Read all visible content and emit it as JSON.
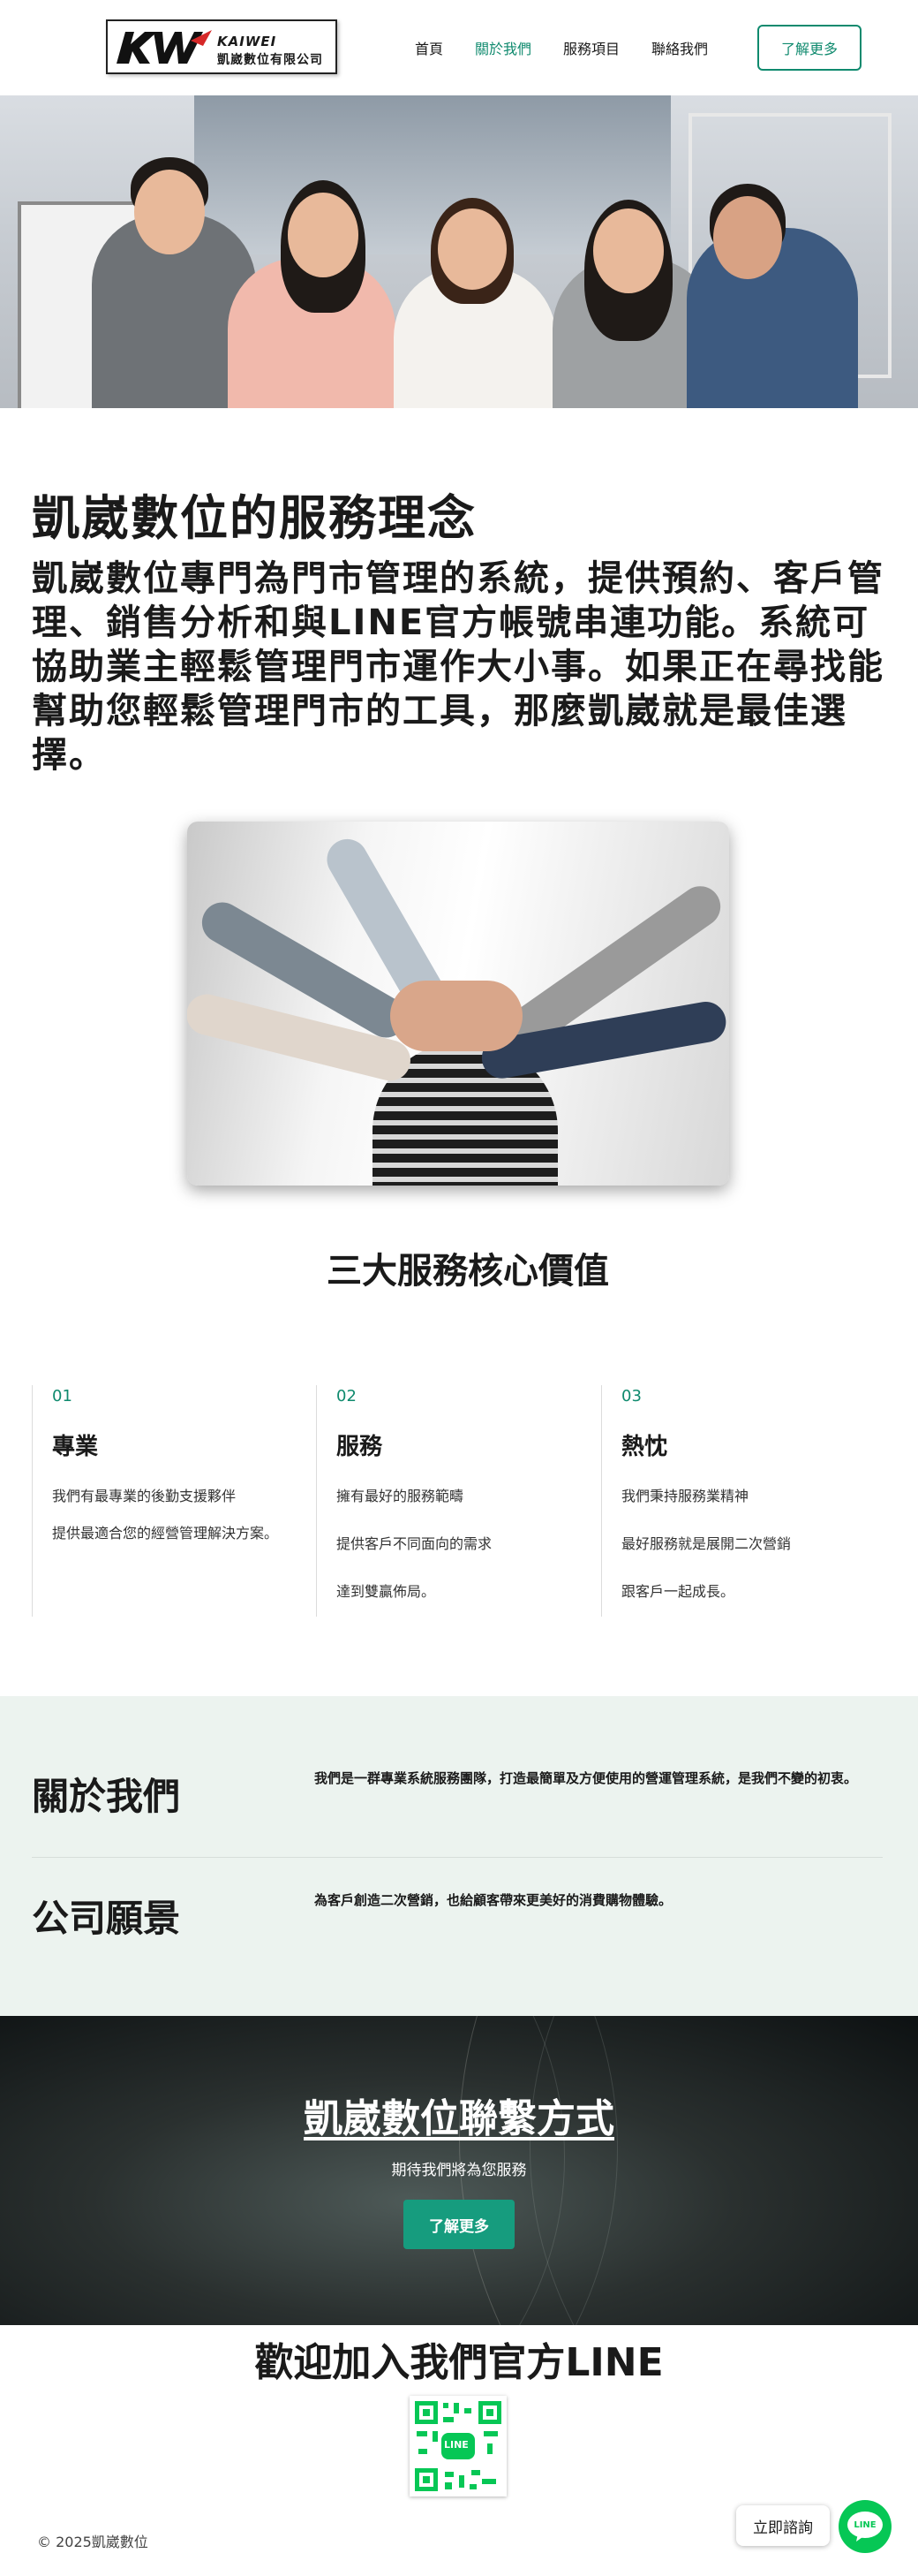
{
  "header": {
    "logo_en": "KAIWEI",
    "logo_zh": "凱崴數位有限公司",
    "nav": [
      "首頁",
      "關於我們",
      "服務項目",
      "聯絡我們"
    ],
    "active_index": 1,
    "cta": "了解更多"
  },
  "philosophy": {
    "title": "凱崴數位的服務理念",
    "text": "凱崴數位專門為門市管理的系統，提供預約、客戶管理、銷售分析和與LINE官方帳號串連功能。系統可協助業主輕鬆管理門市運作大小事。如果正在尋找能幫助您輕鬆管理門市的工具，那麼凱崴就是最佳選擇。"
  },
  "core_values": {
    "title": "三大服務核心價值",
    "columns": [
      {
        "num": "01",
        "head": "專業",
        "lines": [
          "我們有最專業的後勤支援夥伴",
          "提供最適合您的經營管理解決方案。"
        ]
      },
      {
        "num": "02",
        "head": "服務",
        "lines": [
          "擁有最好的服務範疇",
          "提供客戶不同面向的需求",
          "達到雙贏佈局。"
        ]
      },
      {
        "num": "03",
        "head": "熱忱",
        "lines": [
          "我們秉持服務業精神",
          "最好服務就是展開二次營銷",
          "跟客戶一起成長。"
        ]
      }
    ]
  },
  "about": {
    "about_title": "關於我們",
    "about_text": "我們是一群專業系統服務團隊，打造最簡單及方便使用的營運管理系統，是我們不變的初衷。",
    "vision_title": "公司願景",
    "vision_text": "為客戶創造二次營銷，也給顧客帶來更美好的消費購物體驗。"
  },
  "contact": {
    "title": "凱崴數位聯繫方式",
    "subtitle": "期待我們將為您服務",
    "button": "了解更多"
  },
  "line_section": {
    "title": "歡迎加入我們官方LINE",
    "qr_label": "LINE"
  },
  "footer": {
    "copyright": "© 2025凱崴數位",
    "chat_label": "立即諮詢",
    "line_fab_label": "LINE"
  },
  "colors": {
    "accent": "#0f8a6e",
    "button": "#169c7e",
    "band": "#ecf3ef",
    "line_green": "#06c755"
  }
}
